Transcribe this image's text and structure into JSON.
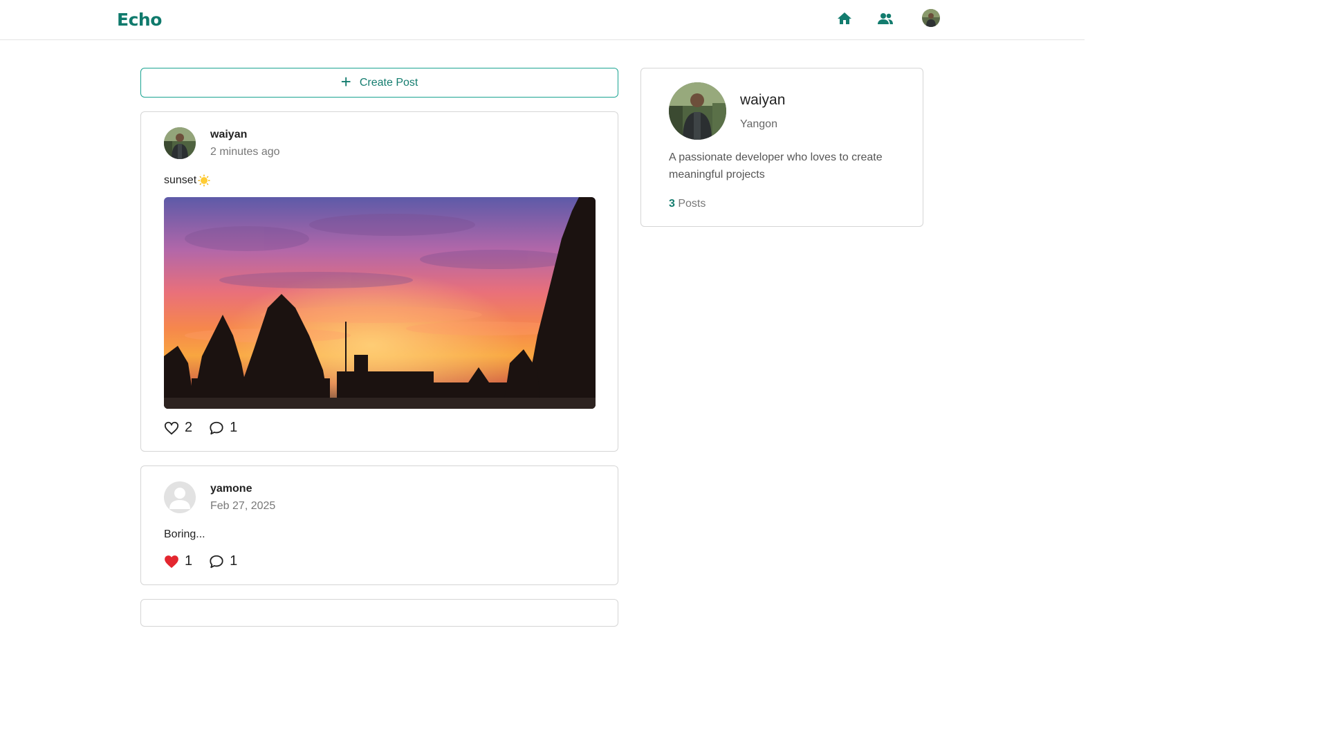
{
  "app": {
    "brand": "Echo",
    "accent": "#137c6e"
  },
  "nav": {
    "icons": [
      "home-icon",
      "friends-icon",
      "user-avatar"
    ]
  },
  "create_post": {
    "label": "Create Post"
  },
  "posts": [
    {
      "author": "waiyan",
      "time": "2 minutes ago",
      "content": "sunset",
      "emoji": "sun-emoji",
      "likes": "2",
      "comments": "1",
      "liked": false
    },
    {
      "author": "yamone",
      "time": "Feb 27, 2025",
      "content": "Boring...",
      "likes": "1",
      "comments": "1",
      "liked": true
    }
  ],
  "profile": {
    "name": "waiyan",
    "location": "Yangon",
    "bio": "A passionate developer who loves to create meaningful projects",
    "posts_count": "3",
    "posts_label": "Posts"
  }
}
